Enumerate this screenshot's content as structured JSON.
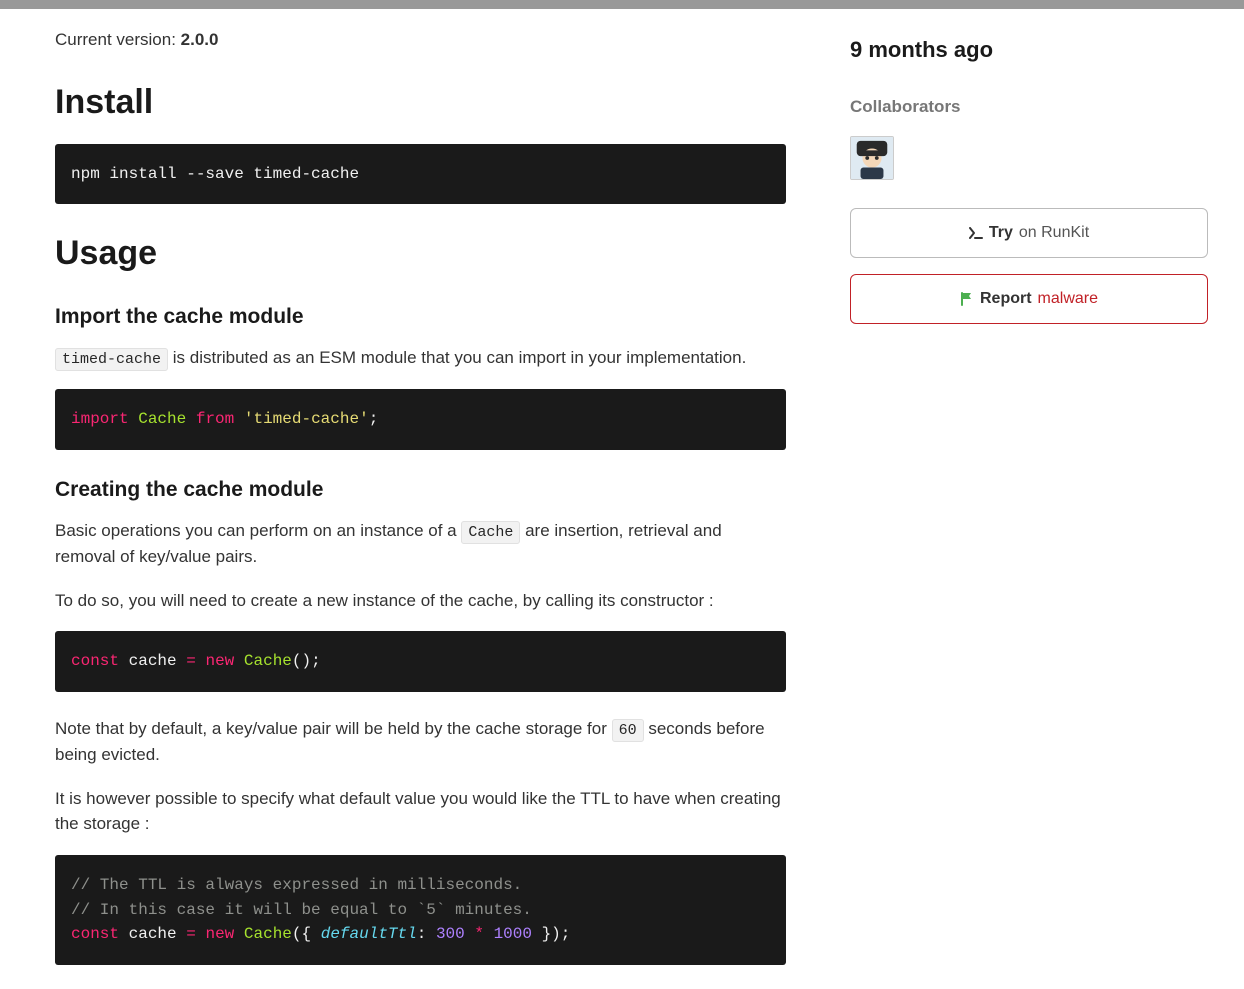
{
  "version": {
    "label": "Current version: ",
    "value": "2.0.0"
  },
  "headings": {
    "install": "Install",
    "usage": "Usage",
    "import_module": "Import the cache module",
    "creating_module": "Creating the cache module"
  },
  "code": {
    "install_cmd": "npm install --save timed-cache",
    "import_line": {
      "kw_import": "import",
      "class_name": "Cache",
      "kw_from": "from",
      "string": "'timed-cache'",
      "semi": ";"
    },
    "new_cache": {
      "kw_const": "const",
      "var": "cache",
      "assign": "=",
      "kw_new": "new",
      "class_name": "Cache",
      "parens": "();"
    },
    "ttl_block": {
      "comment1": "// The TTL is always expressed in milliseconds.",
      "comment2": "// In this case it will be equal to `5` minutes.",
      "kw_const": "const",
      "var": "cache",
      "assign": "=",
      "kw_new": "new",
      "class_name": "Cache",
      "open": "({ ",
      "prop": "defaultTtl",
      "colon": ": ",
      "num1": "300",
      "op": " * ",
      "num2": "1000",
      "close": " });"
    }
  },
  "paragraphs": {
    "import_p_pre": "",
    "import_code": "timed-cache",
    "import_p_post": " is distributed as an ESM module that you can import in your implementation.",
    "basic_ops_pre": "Basic operations you can perform on an instance of a ",
    "basic_ops_code": "Cache",
    "basic_ops_post": " are insertion, retrieval and removal of key/value pairs.",
    "todo_so": "To do so, you will need to create a new instance of the cache, by calling its constructor :",
    "note_pre": "Note that by default, a key/value pair will be held by the cache storage for ",
    "note_code": "60",
    "note_post": " seconds before being evicted.",
    "however": "It is however possible to specify what default value you would like the TTL to have when creating the storage :"
  },
  "sidebar": {
    "time_ago": "9 months ago",
    "collab_label": "Collaborators",
    "try": {
      "bold": "Try",
      "rest": " on RunKit"
    },
    "report": {
      "bold": "Report",
      "rest": " malware"
    }
  }
}
